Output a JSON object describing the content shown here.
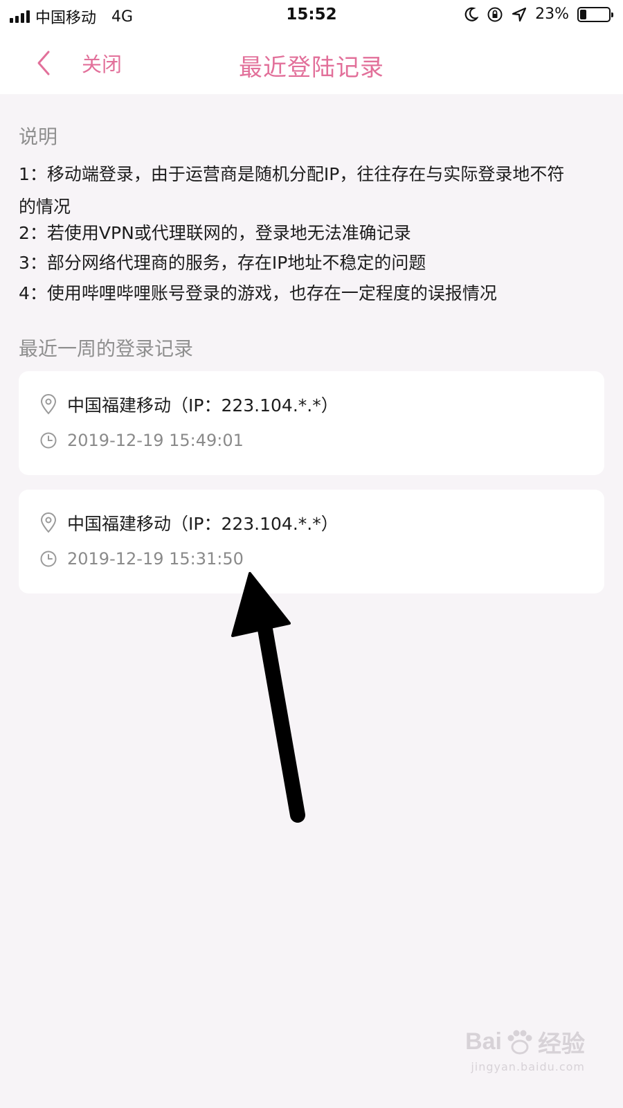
{
  "status_bar": {
    "carrier": "中国移动",
    "network": "4G",
    "time": "15:52",
    "battery_percent": "23%",
    "battery_level": 0.23
  },
  "nav": {
    "close_label": "关闭",
    "title": "最近登陆记录"
  },
  "description": {
    "heading": "说明",
    "lines": [
      "1：移动端登录，由于运营商是随机分配IP，往往存在与实际登录地不符",
      "的情况",
      "2：若使用VPN或代理联网的，登录地无法准确记录",
      "3：部分网络代理商的服务，存在IP地址不稳定的问题",
      "4：使用哔哩哔哩账号登录的游戏，也存在一定程度的误报情况"
    ]
  },
  "records": {
    "heading": "最近一周的登录记录",
    "items": [
      {
        "location": "中国福建移动（IP：223.104.*.*）",
        "time": "2019-12-19 15:49:01"
      },
      {
        "location": "中国福建移动（IP：223.104.*.*）",
        "time": "2019-12-19 15:31:50"
      }
    ]
  },
  "watermark": {
    "brand": "Bai",
    "brand2": "经验",
    "url": "jingyan.baidu.com"
  },
  "colors": {
    "accent": "#e2709a",
    "background": "#f7f4f7",
    "card": "#ffffff",
    "secondary_text": "#8a8a8a"
  }
}
